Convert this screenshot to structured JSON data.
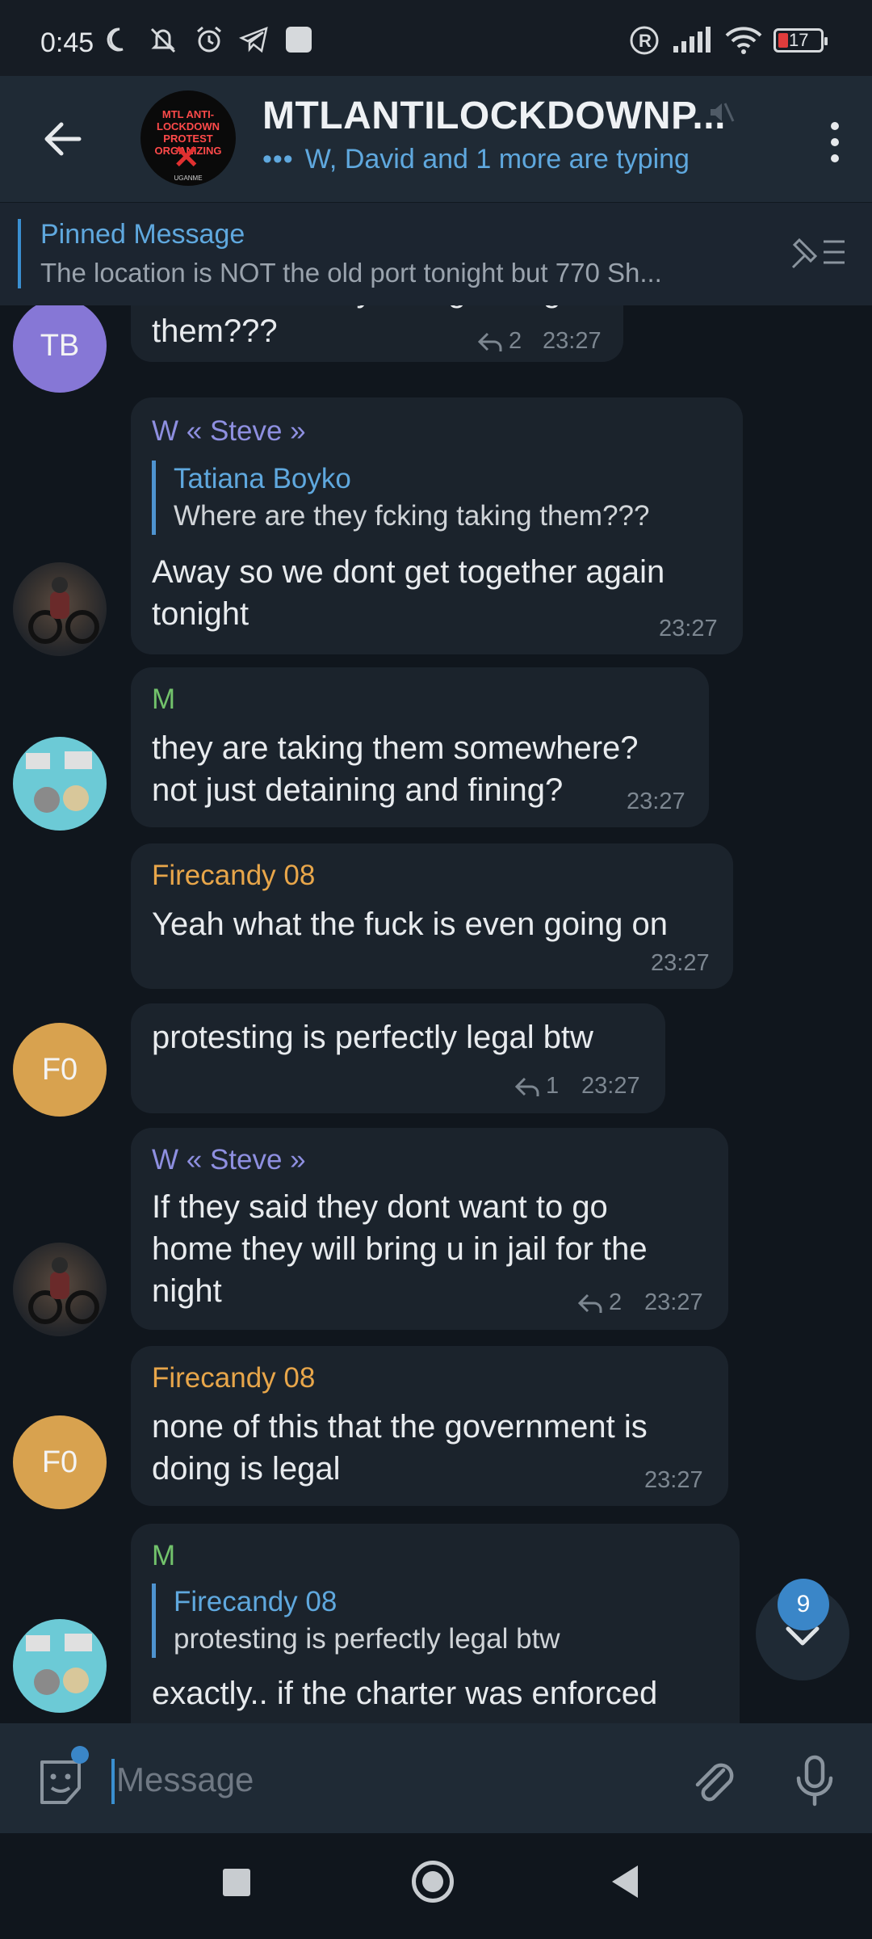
{
  "status_bar": {
    "time": "0:45",
    "battery": "17",
    "icons": [
      "moon-icon",
      "muted-bell-icon",
      "alarm-icon",
      "telegram-icon",
      "app-square-icon",
      "registered-icon",
      "signal-icon",
      "wifi-icon",
      "battery-icon"
    ]
  },
  "header": {
    "title": "MTLANTILOCKDOWNP...",
    "subtitle": "W, David and 1 more are typing",
    "typing_dots": "•••",
    "avatar_text_top": "MTL ANTI-LOCKDOWN PROTEST ORGANIZING",
    "avatar_text_bottom": "UGANME",
    "avatar_mark": "✕"
  },
  "pinned": {
    "title": "Pinned Message",
    "text": "The location is NOT the old port tonight but 770 Sh..."
  },
  "messages": [
    {
      "sender_initials": "TB",
      "text_partial": "Where are they fcking taking",
      "text": "them???",
      "replies": "2",
      "time": "23:27"
    },
    {
      "sender": "W « Steve »",
      "quote_name": "Tatiana Boyko",
      "quote_text": "Where are they fcking taking them???",
      "text_l1": "Away so we dont get together again",
      "text_l2": "tonight",
      "time": "23:27"
    },
    {
      "sender": "M",
      "text_l1": "they are taking them somewhere?",
      "text_l2": "not just detaining and fining?",
      "time": "23:27"
    },
    {
      "sender": "Firecandy 08",
      "text": "Yeah what the fuck is even going on",
      "time": "23:27"
    },
    {
      "sender_initials": "F0",
      "text": "protesting is perfectly legal btw",
      "replies": "1",
      "time": "23:27"
    },
    {
      "sender": "W « Steve »",
      "text_l1": "If they said they dont want to go",
      "text_l2": "home they will bring u in jail for the",
      "text_l3": "night",
      "replies": "2",
      "time": "23:27"
    },
    {
      "sender": "Firecandy 08",
      "sender_initials": "F0",
      "text_l1": "none of this that the government is",
      "text_l2": "doing is legal",
      "time": "23:27"
    },
    {
      "sender": "M",
      "quote_name": "Firecandy 08",
      "quote_text": "protesting is perfectly legal btw",
      "text": "exactly.. if the charter was enforced"
    }
  ],
  "unread_badge": "9",
  "input": {
    "placeholder": "Message"
  },
  "colors": {
    "accent": "#5fa8de",
    "name_purple": "#8e8fe0",
    "name_green": "#72c26b",
    "name_orange": "#e8a64a",
    "avatar_tb": "#8677d6",
    "avatar_f0": "#d8a24f"
  }
}
